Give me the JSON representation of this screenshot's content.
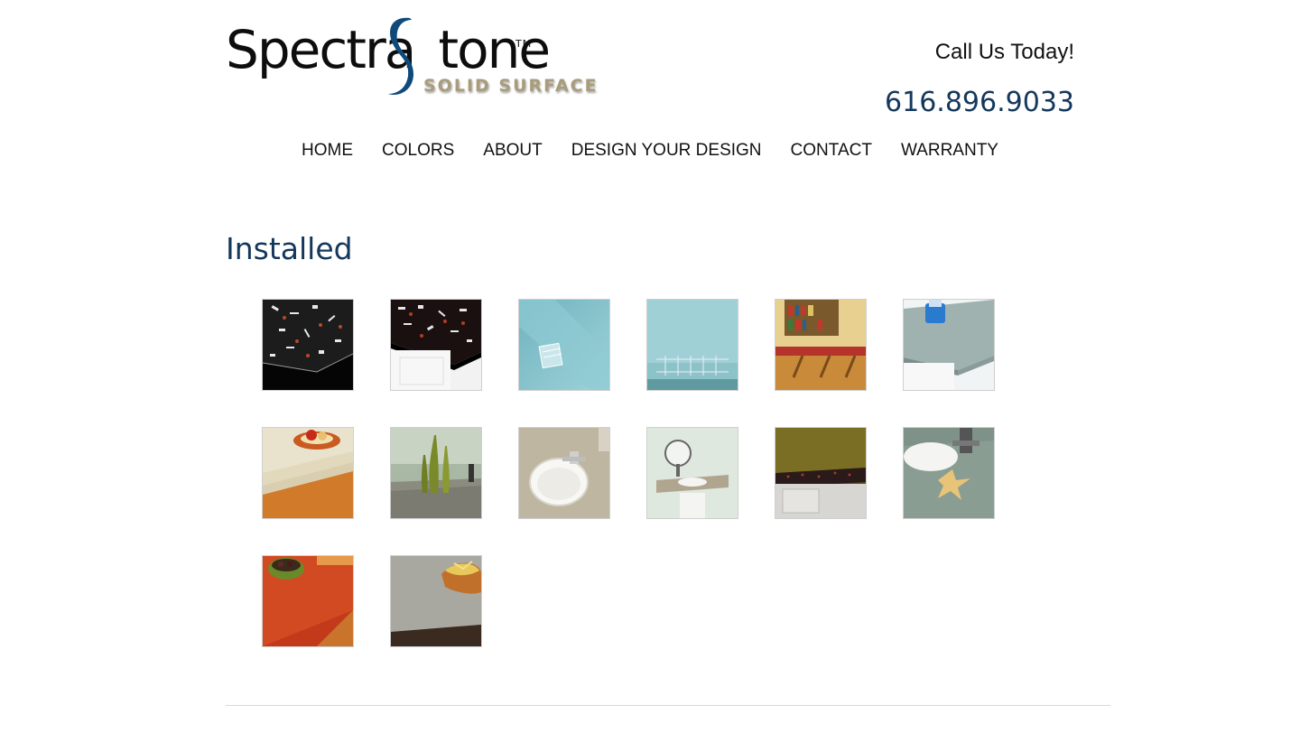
{
  "brand": {
    "logo_word": "Spectra",
    "logo_word2": "tone",
    "logo_tm": "TM",
    "logo_sub": "SOLID SURFACE"
  },
  "contact": {
    "call_label": "Call Us Today!",
    "phone": "616.896.9033"
  },
  "nav": {
    "items": [
      {
        "label": "HOME"
      },
      {
        "label": "COLORS"
      },
      {
        "label": "ABOUT"
      },
      {
        "label": "DESIGN YOUR DESIGN"
      },
      {
        "label": "CONTACT"
      },
      {
        "label": "WARRANTY"
      }
    ]
  },
  "section": {
    "title": "Installed"
  },
  "gallery": {
    "thumbnails": [
      {
        "name": "black-confetti-counter-edge"
      },
      {
        "name": "black-confetti-counter-cabinet"
      },
      {
        "name": "aqua-glass-dish"
      },
      {
        "name": "aqua-glass-rack"
      },
      {
        "name": "red-counter-bookshelf"
      },
      {
        "name": "gray-counter-blue-beaker"
      },
      {
        "name": "beige-counter-apples"
      },
      {
        "name": "gray-vanity-green-vases"
      },
      {
        "name": "tan-vanity-sink"
      },
      {
        "name": "pedestal-sink-mirror"
      },
      {
        "name": "black-counter-cabinet"
      },
      {
        "name": "green-vanity-starfish"
      },
      {
        "name": "red-counter-olives"
      },
      {
        "name": "gray-counter-bread-basket"
      }
    ]
  },
  "colors": {
    "accent": "#14385c",
    "logo_s": "#0f4a7a",
    "logo_sub": "#a89c7a"
  }
}
